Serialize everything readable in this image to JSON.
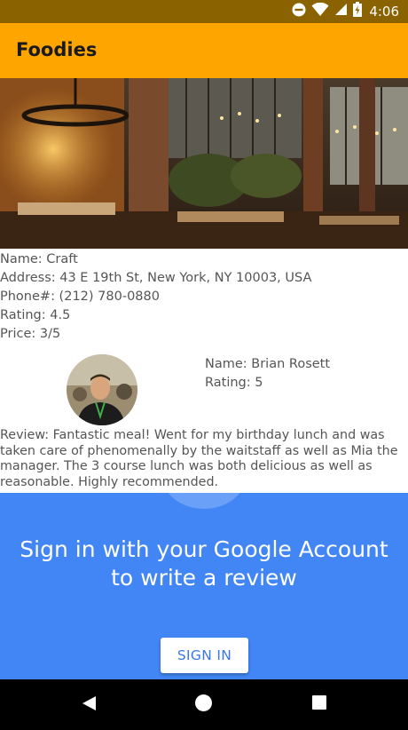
{
  "status_bar": {
    "time": "4:06",
    "icons": [
      "do-not-disturb-icon",
      "wifi-icon",
      "cell-signal-icon",
      "battery-charging-icon"
    ]
  },
  "app_bar": {
    "title": "Foodies",
    "color": "#ffa500"
  },
  "restaurant": {
    "name": "Name: Craft",
    "address": "Address: 43 E 19th St, New York, NY 10003, USA",
    "phone": "Phone#: (212) 780-0880",
    "rating": "Rating: 4.5",
    "price": "Price: 3/5"
  },
  "review": {
    "reviewer_name": "Name: Brian Rosett",
    "reviewer_rating": "Rating: 5",
    "text": " Review: Fantastic meal!  Went for my birthday lunch and was taken care of phenomenally by the waitstaff as well as Mia the manager. The 3 course lunch was both delicious as well as reasonable. Highly recommended."
  },
  "signin": {
    "message": "Sign in with your Google Account to write a review",
    "button_label": "SIGN IN",
    "panel_color": "#4285f4"
  },
  "nav_bar": {
    "icons": [
      "back-icon",
      "home-icon",
      "recents-icon"
    ]
  }
}
